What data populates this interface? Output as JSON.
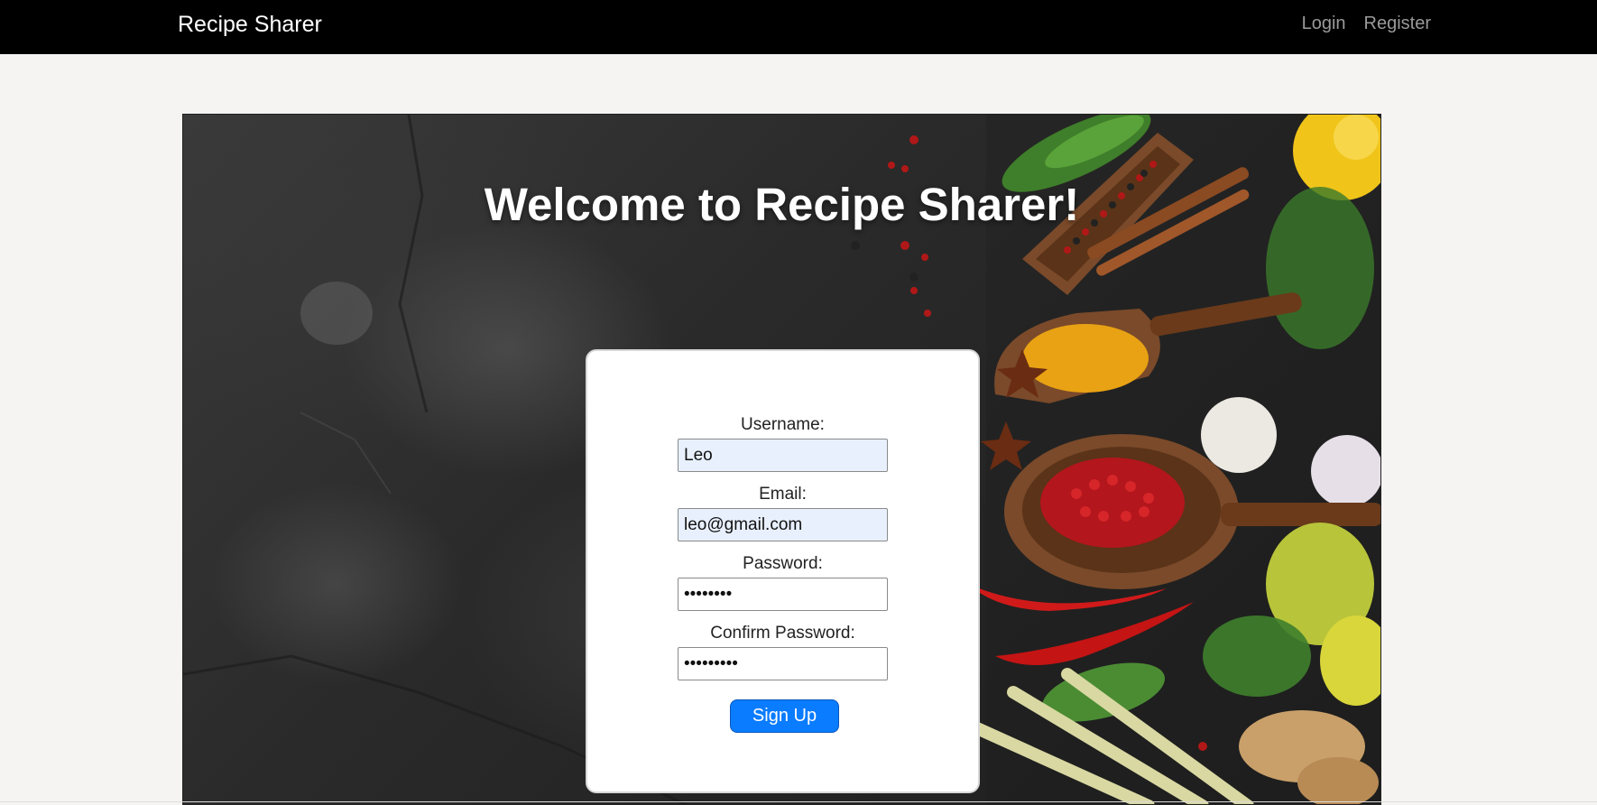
{
  "navbar": {
    "brand": "Recipe Sharer",
    "links": [
      {
        "label": "Login"
      },
      {
        "label": "Register"
      }
    ]
  },
  "hero": {
    "title": "Welcome to Recipe Sharer!",
    "background_image": "spices-on-slate-photo"
  },
  "form": {
    "username_label": "Username:",
    "username_value": "Leo",
    "email_label": "Email:",
    "email_value": "leo@gmail.com",
    "password_label": "Password:",
    "password_value": "••••••••",
    "confirm_label": "Confirm Password:",
    "confirm_value": "•••••••••",
    "submit_label": "Sign Up"
  },
  "colors": {
    "navbar": "#000000",
    "page_background": "#f5f4f2",
    "button": "#0a7cff",
    "autofill_input": "#e8f0fe"
  }
}
